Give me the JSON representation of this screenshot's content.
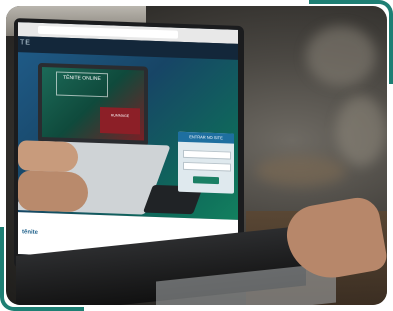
{
  "photo": {
    "subject": "laptop-on-desk",
    "site_header_logo": "TE",
    "url_text": "",
    "hero_logo": "TÊNITE ONLINE",
    "red_panel_text": "RUMMAGE",
    "login_title": "ENTRAR NO SITE",
    "footer_logo": "tênite",
    "footer_texts": [
      "",
      "",
      ""
    ],
    "colors": {
      "frame_accent": "#1e7f74",
      "hero_blue": "#1f5a86",
      "hero_green": "#13805f",
      "red_accent": "#8c1f27"
    }
  }
}
